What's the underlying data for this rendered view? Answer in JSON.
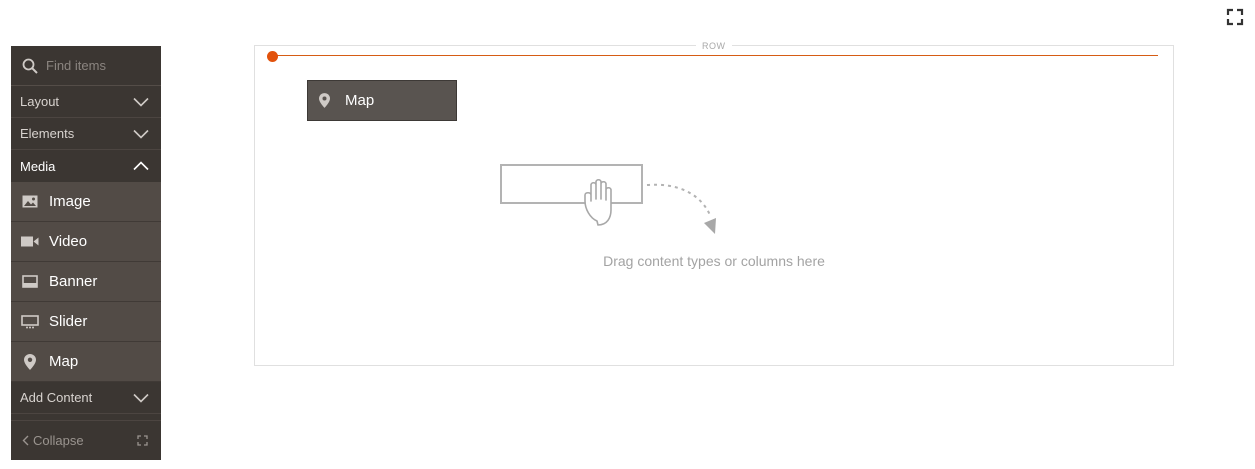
{
  "toolbar": {
    "fullscreen_icon": "fullscreen-icon"
  },
  "panel": {
    "search": {
      "placeholder": "Find items",
      "value": "",
      "icon": "search-icon"
    },
    "sections": {
      "layout": {
        "label": "Layout",
        "state": "collapsed"
      },
      "elements": {
        "label": "Elements",
        "state": "collapsed"
      },
      "media": {
        "label": "Media",
        "state": "expanded",
        "items": [
          {
            "label": "Image",
            "icon": "image-icon"
          },
          {
            "label": "Video",
            "icon": "video-icon"
          },
          {
            "label": "Banner",
            "icon": "banner-icon"
          },
          {
            "label": "Slider",
            "icon": "slider-icon"
          },
          {
            "label": "Map",
            "icon": "map-pin-icon"
          }
        ]
      },
      "add_content": {
        "label": "Add Content",
        "state": "collapsed"
      }
    },
    "collapse": {
      "label": "Collapse",
      "icon": "chevron-left-icon",
      "fullscreen_icon": "fullscreen-icon"
    }
  },
  "stage": {
    "row": {
      "label": "ROW",
      "accent_color": "#e2520c",
      "dragging_item": {
        "label": "Map",
        "icon": "map-pin-icon"
      },
      "drop_hint": "Drag content types or columns here",
      "drop_hint_icon": "drag-hand-icon"
    }
  },
  "colors": {
    "panel_bg": "#3b3632",
    "item_bg": "#524b46",
    "drag_item_bg": "#595450",
    "accent": "#e2520c"
  }
}
